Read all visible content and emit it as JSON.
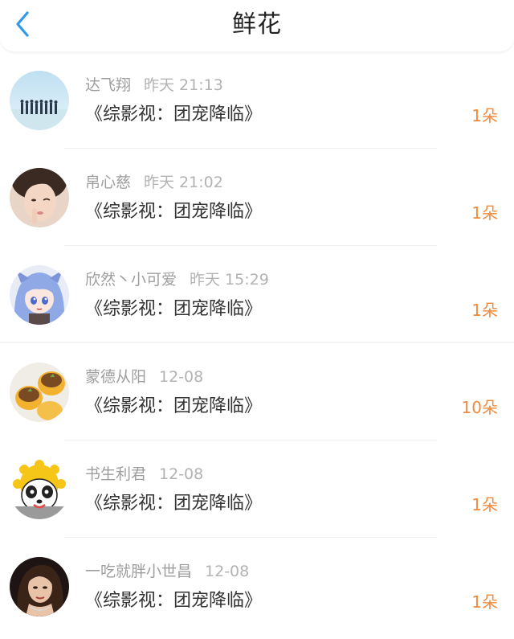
{
  "header": {
    "title": "鲜花",
    "back_icon": "chevron-left-icon"
  },
  "colors": {
    "accent_blue": "#2f9ae8",
    "count_orange": "#f08a3c"
  },
  "items": [
    {
      "name": "达飞翔",
      "time": "昨天 21:13",
      "book": "《综影视：团宠降临》",
      "count": "1朵",
      "avatar": "group-photo-avatar"
    },
    {
      "name": "帛心慈",
      "time": "昨天 21:02",
      "book": "《综影视：团宠降临》",
      "count": "1朵",
      "avatar": "girl-selfie-avatar"
    },
    {
      "name": "欣然丶小可爱",
      "time": "昨天 15:29",
      "book": "《综影视：团宠降临》",
      "count": "1朵",
      "avatar": "anime-girl-avatar"
    },
    {
      "name": "蒙德从阳",
      "time": "12-08",
      "book": "《综影视：团宠降临》",
      "count": "10朵",
      "avatar": "cupcakes-avatar"
    },
    {
      "name": "书生利君",
      "time": "12-08",
      "book": "《综影视：团宠降临》",
      "count": "1朵",
      "avatar": "panda-mascot-avatar"
    },
    {
      "name": "一吃就胖小世昌",
      "time": "12-08",
      "book": "《综影视：团宠降临》",
      "count": "1朵",
      "avatar": "woman-portrait-avatar"
    }
  ]
}
